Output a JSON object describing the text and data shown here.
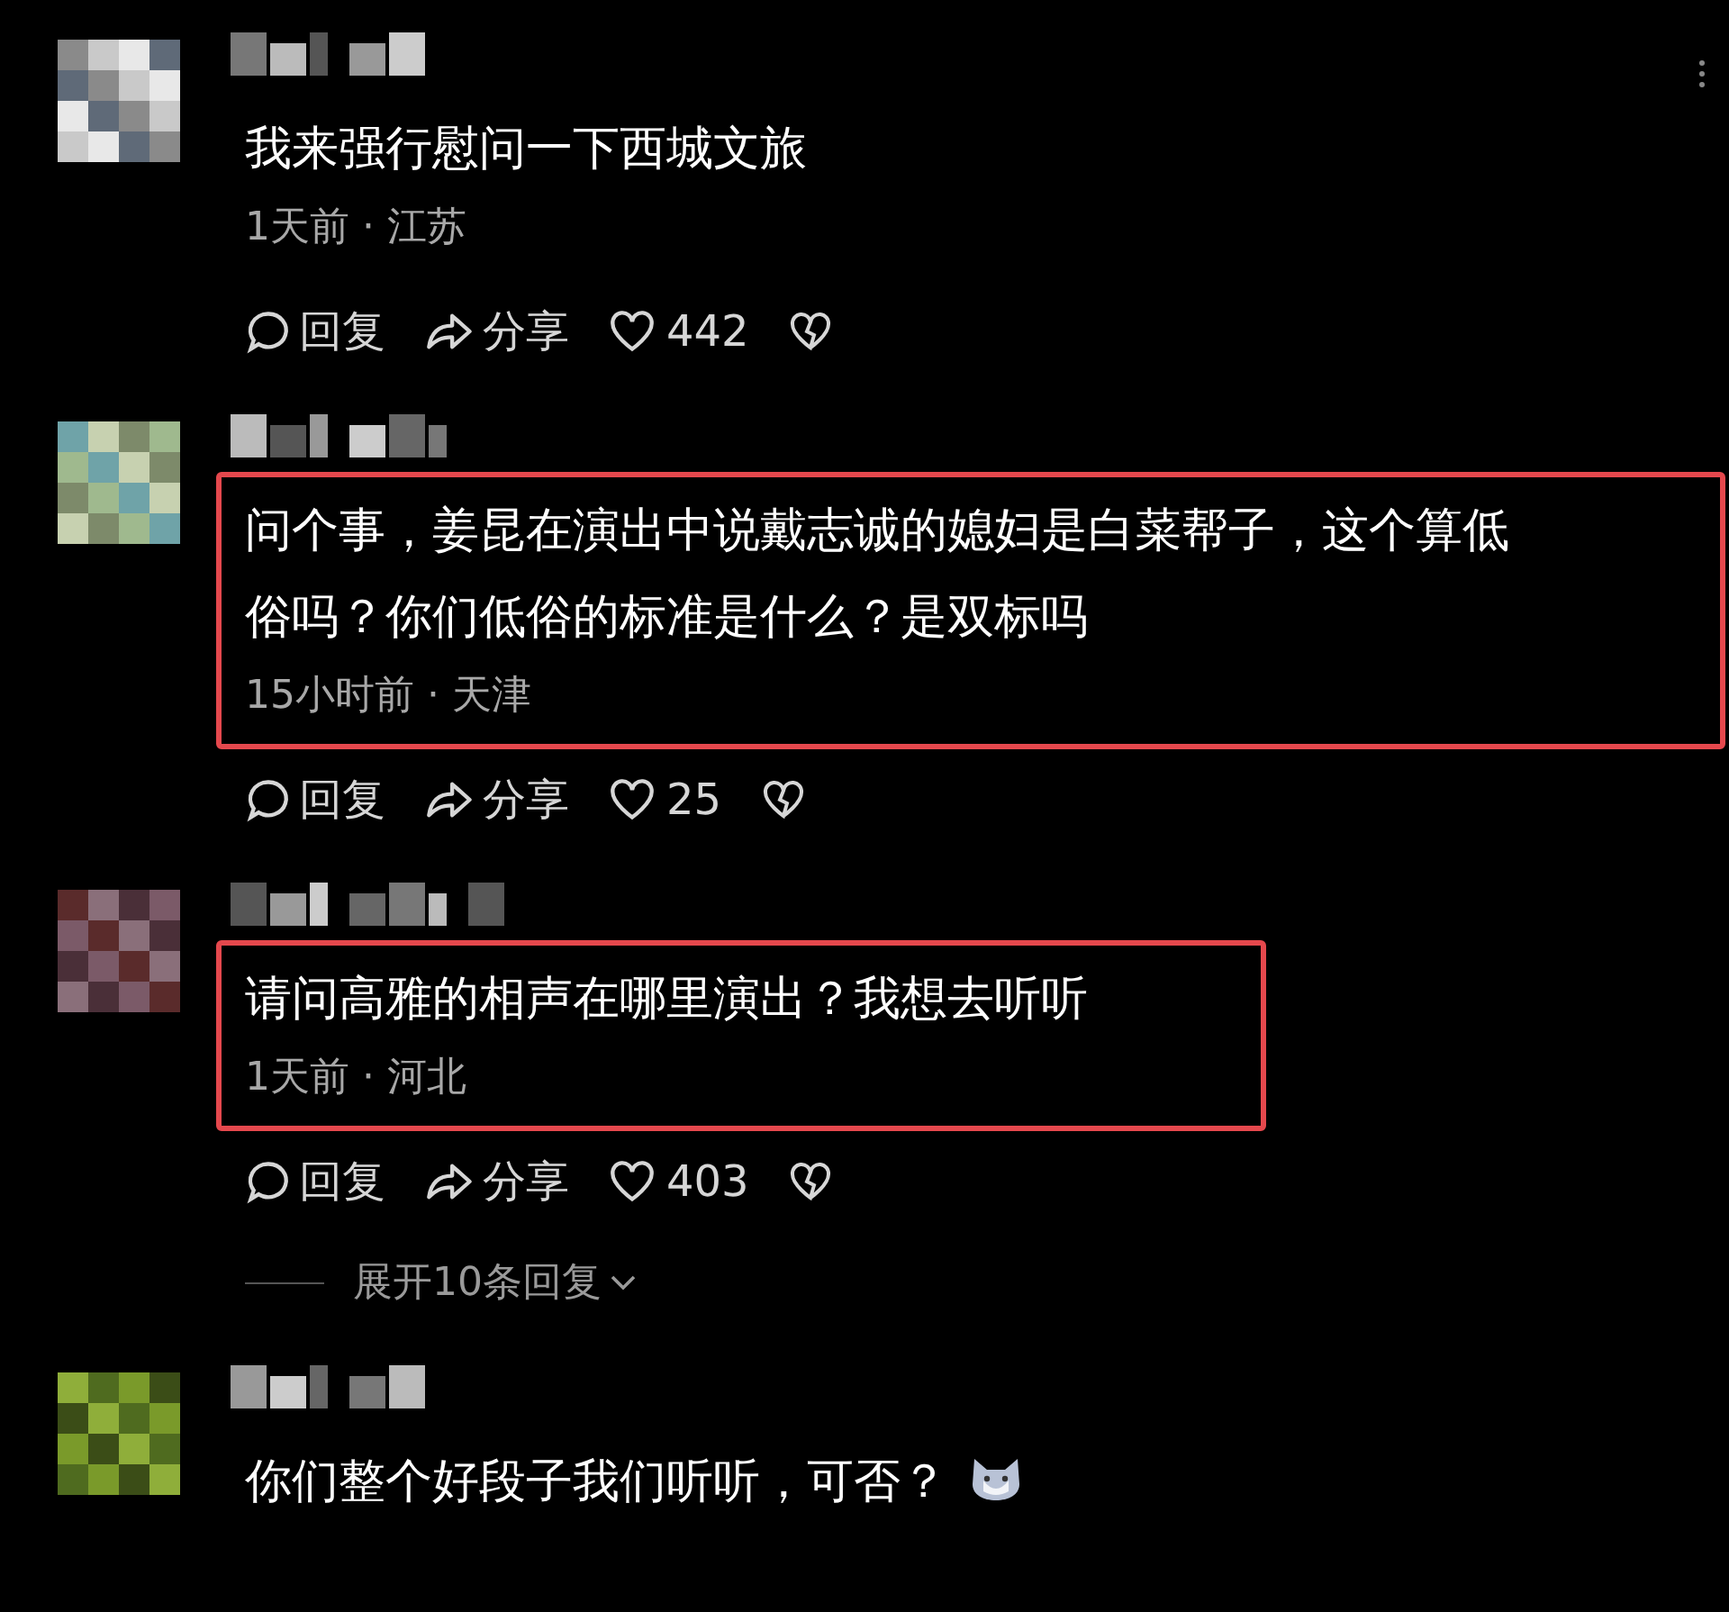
{
  "comments": [
    {
      "text": "我来强行慰问一下西城文旅",
      "meta": "1天前 · 江苏",
      "reply": "回复",
      "share": "分享",
      "likes": "442",
      "highlighted": false,
      "has_emoji": false
    },
    {
      "text": "问个事，姜昆在演出中说戴志诚的媳妇是白菜帮子，这个算低俗吗？你们低俗的标准是什么？是双标吗",
      "meta": "15小时前 · 天津",
      "reply": "回复",
      "share": "分享",
      "likes": "25",
      "highlighted": true,
      "has_emoji": false
    },
    {
      "text": "请问高雅的相声在哪里演出？我想去听听",
      "meta": "1天前 · 河北",
      "reply": "回复",
      "share": "分享",
      "likes": "403",
      "highlighted": true,
      "has_emoji": false,
      "replies_link": "展开10条回复"
    },
    {
      "text": "你们整个好段子我们听听，可否？",
      "highlighted": false,
      "has_emoji": true
    }
  ]
}
